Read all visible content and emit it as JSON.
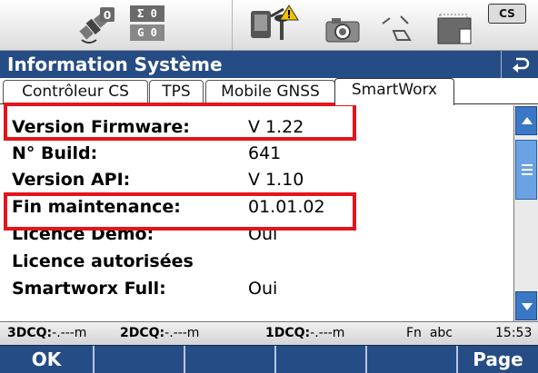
{
  "status_icons": {
    "satellites_icon": "satellite-icon",
    "sat_count": "0",
    "position_counter_top": "Σ 0",
    "position_counter_bottom": "G 0",
    "instrument_icon": "gnss-instrument-icon",
    "camera_icon": "camera-icon",
    "line_icon": "line-tool-icon",
    "battery_icon": "battery-icon",
    "cs_badge": "CS"
  },
  "title": "Information Système",
  "tabs": [
    {
      "label": "Contrôleur CS"
    },
    {
      "label": "TPS"
    },
    {
      "label": "Mobile GNSS"
    },
    {
      "label": "SmartWorx"
    }
  ],
  "active_tab": "SmartWorx",
  "rows": [
    {
      "label": "Version Firmware:",
      "value": "V 1.22"
    },
    {
      "label": "N° Build:",
      "value": "641"
    },
    {
      "label": "Version API:",
      "value": "V 1.10"
    },
    {
      "label": "Fin maintenance:",
      "value": "01.01.02"
    },
    {
      "label": "Licence Demo:",
      "value": "Oui"
    },
    {
      "label": "Licence autorisées",
      "value": ""
    },
    {
      "label": "Smartworx Full:",
      "value": "Oui"
    }
  ],
  "quality": {
    "q3d_label": "3DCQ:",
    "q3d_value": "-.---m",
    "q2d_label": "2DCQ:",
    "q2d_value": "-.---m",
    "q1d_label": "1DCQ:",
    "q1d_value": "-.---m",
    "mode": "Fn  abc",
    "time": "15:53"
  },
  "softkeys": [
    "OK",
    "",
    "",
    "",
    "",
    "Page"
  ],
  "colors": {
    "accent": "#264c86",
    "highlight": "#e5141a",
    "scroll": "#3a78c5"
  }
}
